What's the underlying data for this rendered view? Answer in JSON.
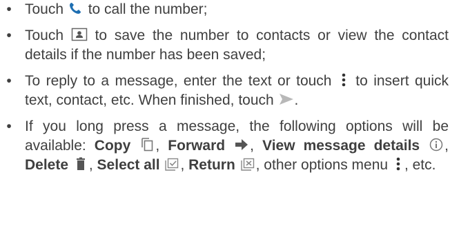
{
  "items": [
    {
      "t1": "Touch ",
      "t2": " to call the number;"
    },
    {
      "t1": "Touch ",
      "t2": " to save the number to contacts or view the contact details if the number has been saved;"
    },
    {
      "t1": "To reply to a message, enter the text or touch ",
      "t2": " to insert quick text, contact, etc. When finished, touch ",
      "t3": "."
    },
    {
      "t1": "If you long press a message, the following options will be available: ",
      "copy": "Copy",
      "sep1": ", ",
      "forward": "Forward",
      "sep2": ", ",
      "view_details": "View message details",
      "sep3": ", ",
      "delete": "Delete",
      "sep4": ", ",
      "select_all": "Select all",
      "sep5": ", ",
      "return": "Return",
      "sep6": ", other options menu ",
      "end": ", etc."
    }
  ],
  "icons": [
    "phone-icon",
    "contact-card-icon",
    "more-vert-icon",
    "send-icon",
    "copy-icon",
    "forward-icon",
    "info-icon",
    "delete-icon",
    "select-all-icon",
    "return-icon",
    "more-vert-icon"
  ],
  "colors": {
    "text": "#3f3f3f",
    "icon": "#555555",
    "send": "#b8b8b8",
    "phone": "#1f6fb2"
  }
}
